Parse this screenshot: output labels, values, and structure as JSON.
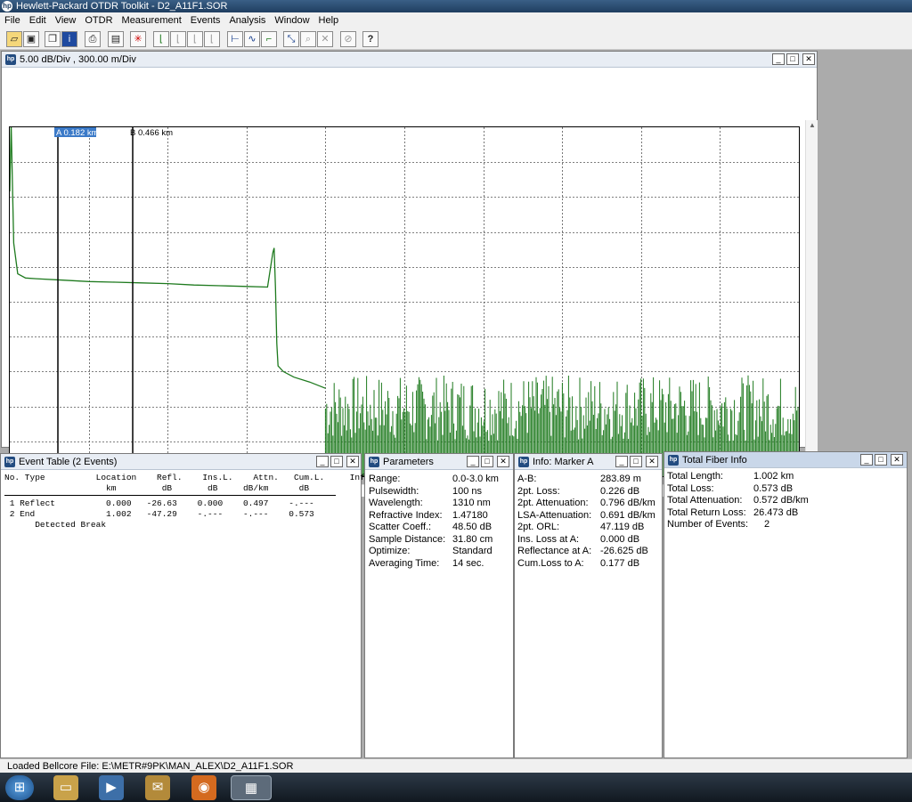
{
  "app": {
    "title": "Hewlett-Packard OTDR Toolkit - D2_A11F1.SOR"
  },
  "menu": [
    "File",
    "Edit",
    "View",
    "OTDR",
    "Measurement",
    "Events",
    "Analysis",
    "Window",
    "Help"
  ],
  "toolbar_icons": [
    "open-icon",
    "save-icon",
    "copy-icon",
    "info-icon",
    "print-icon",
    "device-icon",
    "cursor-icon",
    "marker-1-icon",
    "marker-2-icon",
    "marker-3-icon",
    "marker-4-icon",
    "span-icon",
    "splice-icon",
    "level-icon",
    "zoom-fit-icon",
    "zoom-icon",
    "zoom-out-icon",
    "cancel-icon",
    "help-icon"
  ],
  "trace_window": {
    "title": "5.00 dB/Div ,  300.00 m/Div",
    "marker_a": "A 0.182 km",
    "marker_b": "B 0.466 km",
    "color": "#1e7a1e"
  },
  "chart_data": {
    "type": "line",
    "title": "",
    "xlabel": "",
    "ylabel": "",
    "x_scale_per_div": "300.00 m/Div",
    "y_scale_per_div": "5.00 dB/Div",
    "series": [
      {
        "x": [
          0.0,
          0.005,
          0.015,
          0.03,
          0.06,
          0.1,
          0.2,
          0.3,
          0.4,
          0.5,
          0.6,
          0.7,
          0.8,
          0.9,
          0.98,
          1.0,
          1.005,
          1.01,
          1.015,
          1.02,
          1.04,
          1.08,
          1.14,
          1.2
        ],
        "y": [
          40.8,
          50.6,
          33.4,
          29.0,
          28.4,
          28.3,
          28.1,
          27.9,
          27.8,
          27.7,
          27.6,
          27.4,
          27.3,
          27.2,
          27.1,
          32.0,
          32.7,
          27.0,
          19.0,
          15.8,
          15.0,
          14.2,
          13.5,
          12.6
        ]
      }
    ],
    "noise_floor": {
      "x_range": [
        1.2,
        3.0
      ],
      "y_range": [
        0,
        14.5
      ]
    },
    "grid": true
  },
  "event_table": {
    "title": "Event Table (2 Events)",
    "header": "No. Type          Location    Refl.    Ins.L.    Attn.   Cum.L.     Info\n                    km         dB       dB     dB/km      dB",
    "rows": [
      " 1 Reflect          0.000   -26.63    0.000    0.497    -.---",
      " 2 End              1.002   -47.29    -.---    -.---    0.573",
      "      Detected Break"
    ]
  },
  "parameters": {
    "title": "Parameters",
    "items": [
      {
        "k": "Range:",
        "v": "0.0-3.0 km"
      },
      {
        "k": "Pulsewidth:",
        "v": "100 ns"
      },
      {
        "k": "Wavelength:",
        "v": "1310 nm"
      },
      {
        "k": "Refractive Index:",
        "v": "1.47180"
      },
      {
        "k": "Scatter Coeff.:",
        "v": "48.50 dB"
      },
      {
        "k": "Sample Distance:",
        "v": "31.80 cm"
      },
      {
        "k": "Optimize:",
        "v": "Standard"
      },
      {
        "k": "Averaging Time:",
        "v": "14 sec."
      }
    ]
  },
  "info_marker": {
    "title": "Info: Marker A",
    "items": [
      {
        "k": "A-B:",
        "v": "283.89 m"
      },
      {
        "k": "2pt. Loss:",
        "v": "0.226 dB"
      },
      {
        "k": "2pt. Attenuation:",
        "v": "0.796 dB/km"
      },
      {
        "k": "LSA-Attenuation:",
        "v": "0.691 dB/km"
      },
      {
        "k": "2pt. ORL:",
        "v": "47.119 dB"
      },
      {
        "k": "Ins. Loss at A:",
        "v": "0.000 dB"
      },
      {
        "k": "Reflectance at A:",
        "v": "-26.625 dB"
      },
      {
        "k": "Cum.Loss to A:",
        "v": "0.177 dB"
      }
    ]
  },
  "fiber_info": {
    "title": "Total Fiber Info",
    "items": [
      {
        "k": "Total Length:",
        "v": "1.002 km"
      },
      {
        "k": "Total Loss:",
        "v": "0.573 dB"
      },
      {
        "k": "Total Attenuation:",
        "v": "0.572 dB/km"
      },
      {
        "k": "Total Return Loss:",
        "v": "26.473 dB"
      },
      {
        "k": "Number of Events:",
        "v": "2"
      }
    ]
  },
  "status": "Loaded Bellcore File:  E:\\METR#9PK\\MAN_ALEX\\D2_A11F1.SOR",
  "taskbar_items": [
    "start-orb-icon",
    "explorer-icon",
    "media-player-icon",
    "mail-icon",
    "firefox-icon",
    "otdr-app-icon"
  ]
}
